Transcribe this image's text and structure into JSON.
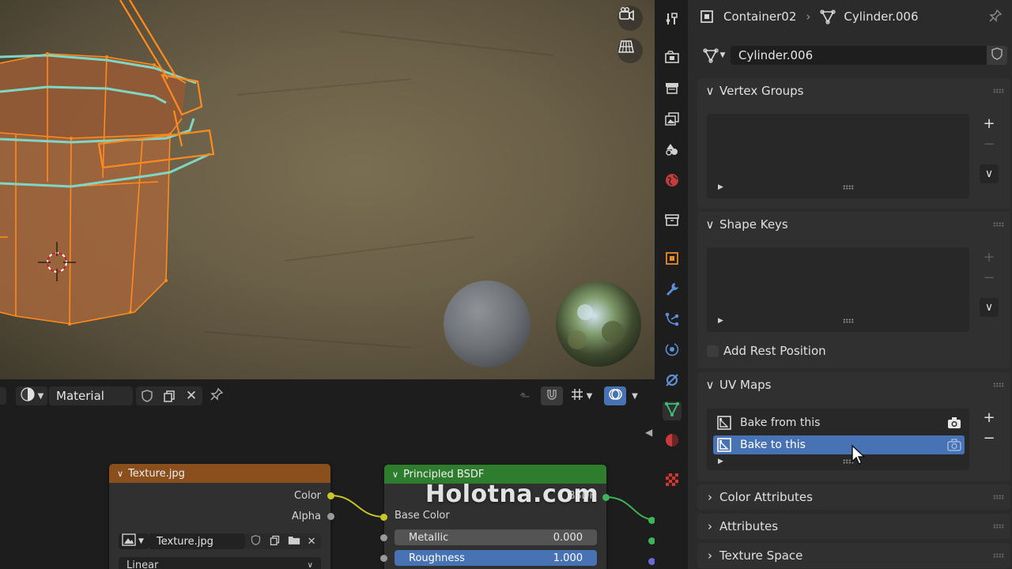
{
  "viewport": {},
  "node_editor": {
    "shader_type_label": "Material",
    "texture_node": {
      "title": "Texture.jpg",
      "outputs": [
        "Color",
        "Alpha"
      ],
      "image_name": "Texture.jpg",
      "interpolation": "Linear"
    },
    "bsdf_node": {
      "title": "Principled BSDF",
      "output": "BSDF",
      "base_color_label": "Base Color",
      "metallic_label": "Metallic",
      "metallic_value": "0.000",
      "roughness_label": "Roughness",
      "roughness_value": "1.000",
      "roughness_fraction": 1.0
    },
    "watermark": "Holotna.com"
  },
  "properties": {
    "breadcrumb": {
      "object": "Container02",
      "mesh": "Cylinder.006"
    },
    "mesh_name": "Cylinder.006",
    "vertex_groups": {
      "title": "Vertex Groups"
    },
    "shape_keys": {
      "title": "Shape Keys",
      "add_rest_position_label": "Add Rest Position",
      "add_rest_position_checked": false
    },
    "uv_maps": {
      "title": "UV Maps",
      "items": [
        {
          "label": "Bake from this",
          "active_render": true,
          "selected": false
        },
        {
          "label": "Bake to this",
          "active_render": false,
          "selected": true
        }
      ]
    },
    "collapsed_panels": [
      "Color Attributes",
      "Attributes",
      "Texture Space"
    ]
  },
  "colors": {
    "accent_blue": "#4772b3",
    "texture_header": "#8b4e1d",
    "bsdf_header": "#2e7d2e",
    "selection_orange": "#ff8a1d",
    "uv_edges": "#7fd6c4",
    "socket_yellow": "#c7c729"
  }
}
